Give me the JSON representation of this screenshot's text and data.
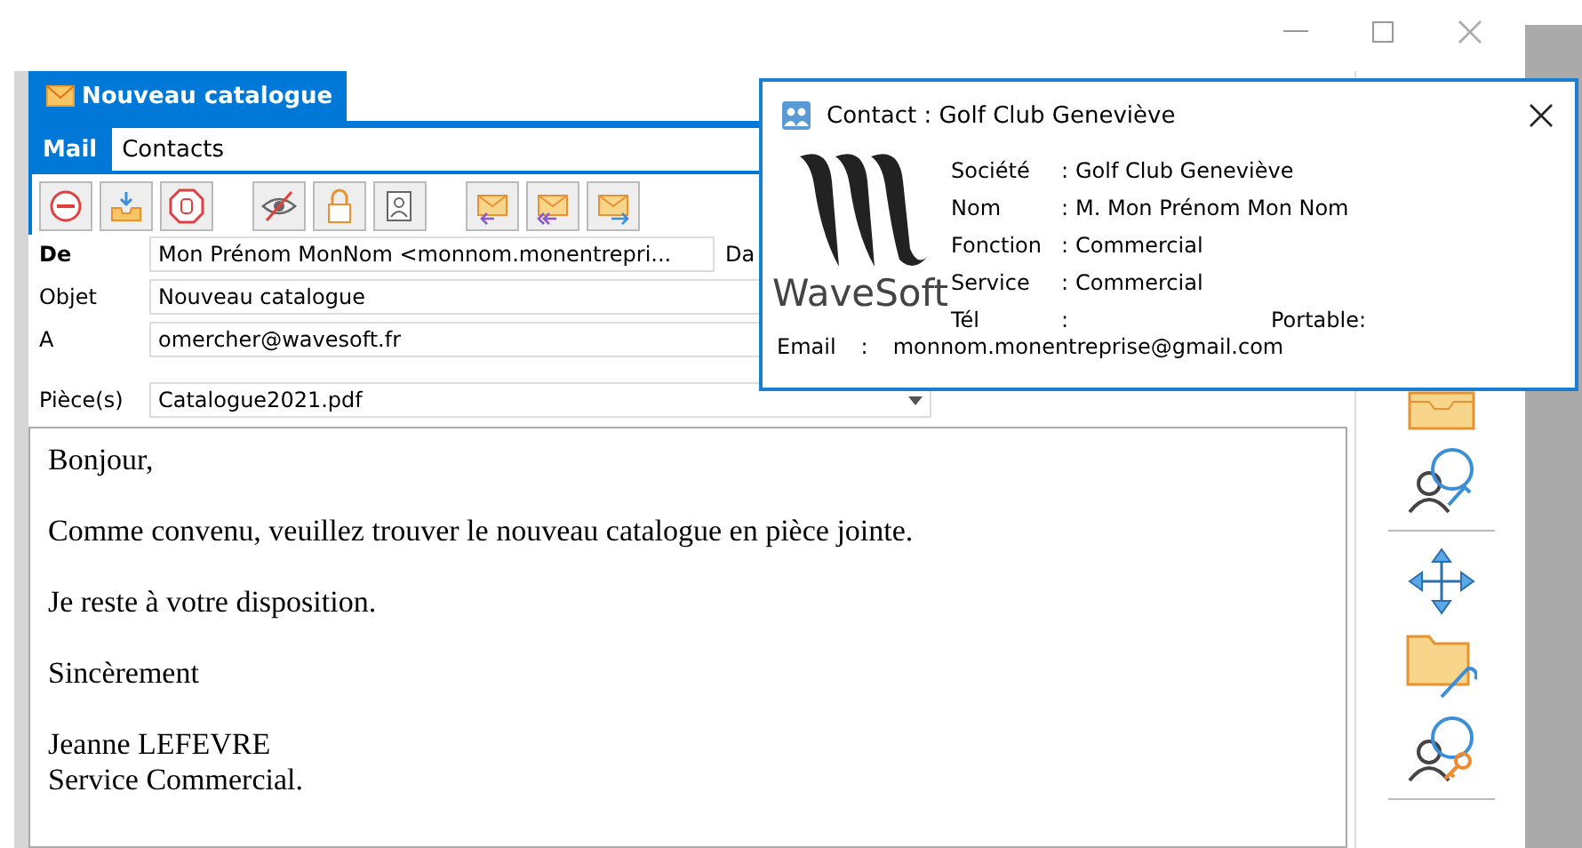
{
  "mail_window": {
    "tab_title": "Nouveau catalogue",
    "ribbon_tabs": [
      {
        "label": "Mail",
        "selected": true
      },
      {
        "label": "Contacts",
        "selected": false
      }
    ],
    "fields": [
      {
        "label": "De",
        "value": "Mon Prénom MonNom <monnom.monentrepri...",
        "bold": true,
        "kind": "text"
      },
      {
        "label": "Objet",
        "value": "Nouveau catalogue",
        "bold": false,
        "kind": "text"
      },
      {
        "label": "A",
        "value": "omercher@wavesoft.fr",
        "bold": false,
        "kind": "text"
      },
      {
        "label": "Pièce(s)",
        "value": "Catalogue2021.pdf",
        "bold": false,
        "kind": "dropdown"
      }
    ],
    "date_label": "Da",
    "body": [
      "Bonjour,",
      "Comme convenu, veuillez trouver le nouveau catalogue en pièce jointe.",
      "Je reste à votre disposition.",
      "Sincèrement"
    ],
    "signature": [
      "Jeanne LEFEVRE",
      "Service Commercial."
    ]
  },
  "contact_popup": {
    "title": "Contact : Golf Club Geneviève",
    "logo_text": "WaveSoft",
    "fields": [
      {
        "label": "Société",
        "separator": ":",
        "value": "Golf Club Geneviève"
      },
      {
        "label": "Nom",
        "separator": ":",
        "value": "M. Mon Prénom Mon Nom"
      },
      {
        "label": "Fonction",
        "separator": ":",
        "value": "Commercial"
      },
      {
        "label": "Service",
        "separator": ":",
        "value": "Commercial"
      },
      {
        "label": "Tél",
        "separator": ":",
        "extra_label": "Portable:"
      }
    ],
    "email": {
      "label": "Email",
      "separator": ":",
      "value": "monnom.monentreprise@gmail.com"
    }
  }
}
